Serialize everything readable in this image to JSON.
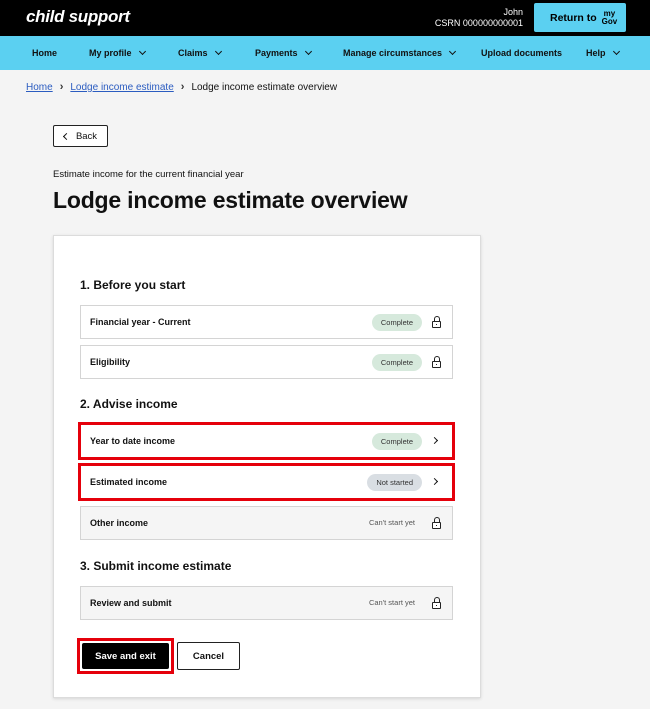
{
  "header": {
    "brand": "child support",
    "user_name": "John",
    "csrn": "CSRN 000000000001",
    "return_label": "Return to",
    "mygov_top": "my",
    "mygov_bottom": "Gov"
  },
  "nav": {
    "items": [
      {
        "label": "Home",
        "dropdown": false
      },
      {
        "label": "My profile",
        "dropdown": true
      },
      {
        "label": "Claims",
        "dropdown": true
      },
      {
        "label": "Payments",
        "dropdown": true
      },
      {
        "label": "Manage circumstances",
        "dropdown": true
      },
      {
        "label": "Upload documents",
        "dropdown": false
      },
      {
        "label": "Help",
        "dropdown": true
      }
    ]
  },
  "breadcrumb": [
    "Home",
    "Lodge income estimate",
    "Lodge income estimate overview"
  ],
  "back_label": "Back",
  "subtitle": "Estimate income for the current financial year",
  "title": "Lodge income estimate overview",
  "sections": [
    {
      "heading": "1. Before you start",
      "tasks": [
        {
          "label": "Financial year - Current",
          "status": "Complete",
          "icon": "lock-icon"
        },
        {
          "label": "Eligibility",
          "status": "Complete",
          "icon": "lock-icon"
        }
      ]
    },
    {
      "heading": "2. Advise income",
      "tasks": [
        {
          "label": "Year to date income",
          "status": "Complete",
          "icon": "chevron-right-icon"
        },
        {
          "label": "Estimated income",
          "status": "Not started",
          "icon": "chevron-right-icon"
        },
        {
          "label": "Other income",
          "status": "Can't start yet",
          "icon": "lock-icon"
        }
      ]
    },
    {
      "heading": "3. Submit income estimate",
      "tasks": [
        {
          "label": "Review and submit",
          "status": "Can't start yet",
          "icon": "lock-icon"
        }
      ]
    }
  ],
  "buttons": {
    "save_exit": "Save and exit",
    "cancel": "Cancel"
  },
  "colors": {
    "topbar": "#000000",
    "nav": "#5bd0f1",
    "link": "#2b5cc0",
    "complete_badge": "#d6e9dc",
    "not_started_badge": "#d9dee3",
    "highlight": "#e5000b"
  }
}
